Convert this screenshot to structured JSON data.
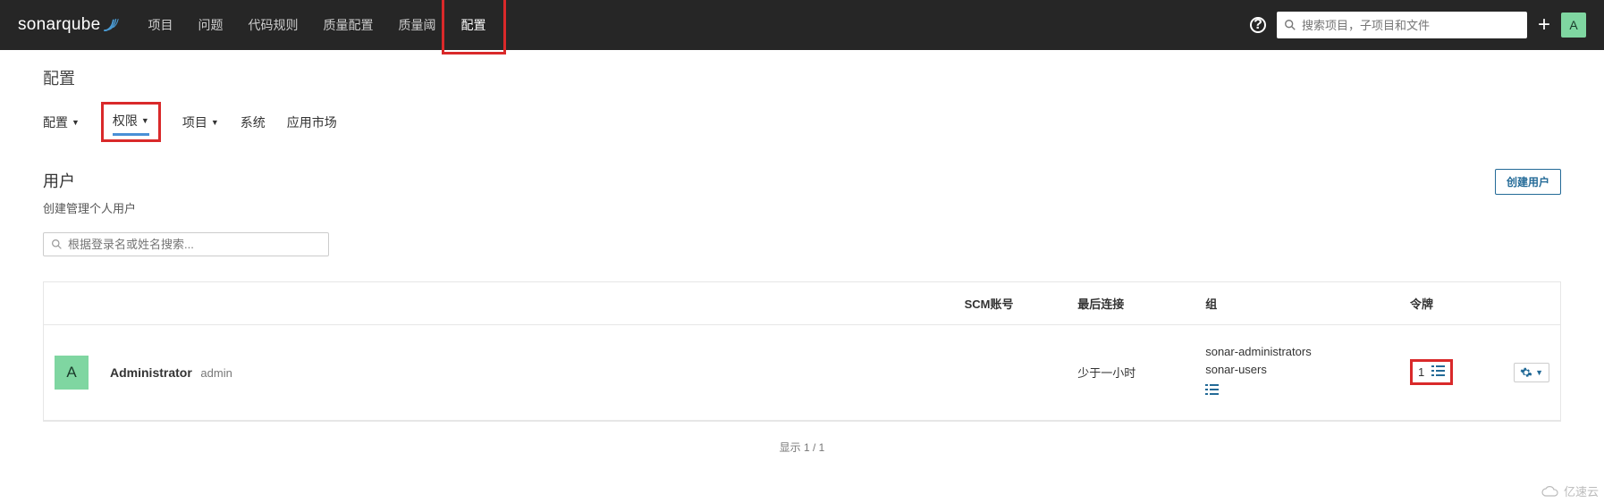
{
  "brand": "sonarqube",
  "top_nav": {
    "items": [
      "项目",
      "问题",
      "代码规则",
      "质量配置",
      "质量阈",
      "配置"
    ],
    "search_placeholder": "搜索项目，子项目和文件",
    "avatar_letter": "A"
  },
  "page_title": "配置",
  "sub_tabs": [
    {
      "label": "配置",
      "has_caret": true
    },
    {
      "label": "权限",
      "has_caret": true
    },
    {
      "label": "项目",
      "has_caret": true
    },
    {
      "label": "系统",
      "has_caret": false
    },
    {
      "label": "应用市场",
      "has_caret": false
    }
  ],
  "section": {
    "title": "用户",
    "subtitle": "创建管理个人用户",
    "create_button": "创建用户"
  },
  "filter": {
    "placeholder": "根据登录名或姓名搜索..."
  },
  "table": {
    "headers": {
      "scm": "SCM账号",
      "last_conn": "最后连接",
      "groups": "组",
      "tokens": "令牌"
    },
    "row": {
      "avatar": "A",
      "name": "Administrator",
      "login": "admin",
      "last_conn": "少于一小时",
      "groups": [
        "sonar-administrators",
        "sonar-users"
      ],
      "token_count": "1"
    }
  },
  "footer": "显示 1 / 1",
  "watermark": "亿速云"
}
